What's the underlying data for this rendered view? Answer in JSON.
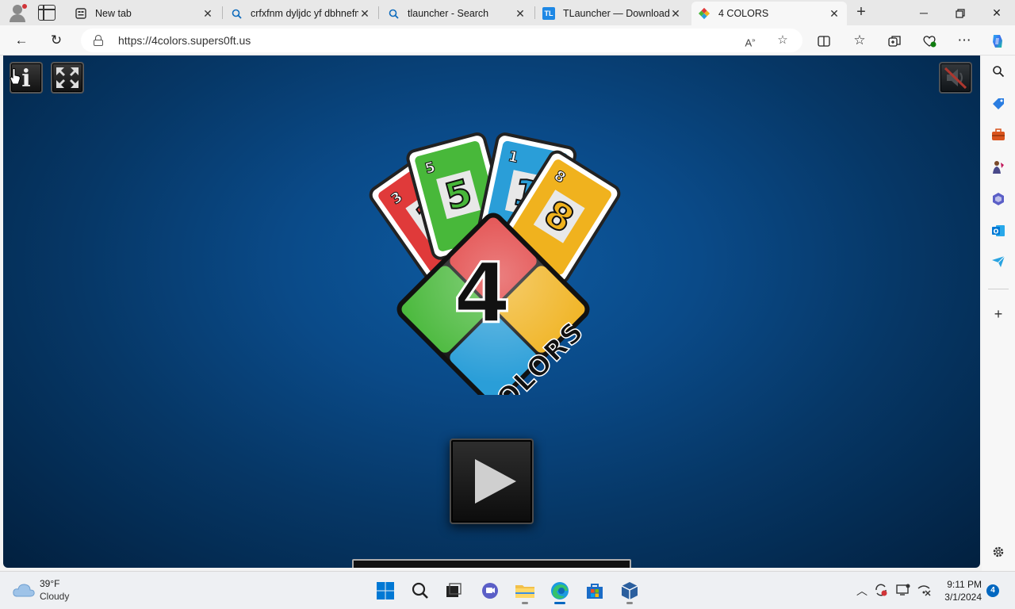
{
  "tabs": [
    {
      "title": "New tab",
      "icon": "newtab-page-icon",
      "active": false
    },
    {
      "title": "crfxfnm dyljdc yf dbhnefmye",
      "icon": "search-icon",
      "active": false
    },
    {
      "title": "tlauncher - Search",
      "icon": "search-icon",
      "active": false
    },
    {
      "title": "TLauncher — Download",
      "icon": "tlauncher-icon",
      "icon_text": "TL",
      "active": false
    },
    {
      "title": "4 COLORS",
      "icon": "4colors-icon",
      "active": true
    }
  ],
  "address": {
    "url": "https://4colors.supers0ft.us"
  },
  "game": {
    "title": "4 COLORS",
    "logo_number": "4",
    "logo_word": "COLORS",
    "card_numbers": [
      "3",
      "5",
      "1",
      "8"
    ],
    "colors": {
      "red": "#e03a3a",
      "green": "#48b83a",
      "blue": "#2a9ed8",
      "yellow": "#f0b21e",
      "background": "#0a4a88"
    },
    "info_label": "i"
  },
  "taskbar": {
    "weather_temp": "39°F",
    "weather_condition": "Cloudy",
    "time": "9:11 PM",
    "date": "3/1/2024",
    "notification_count": "4"
  },
  "colors": {
    "accent": "#0067c0",
    "tab_strip": "#e8e8e8"
  }
}
